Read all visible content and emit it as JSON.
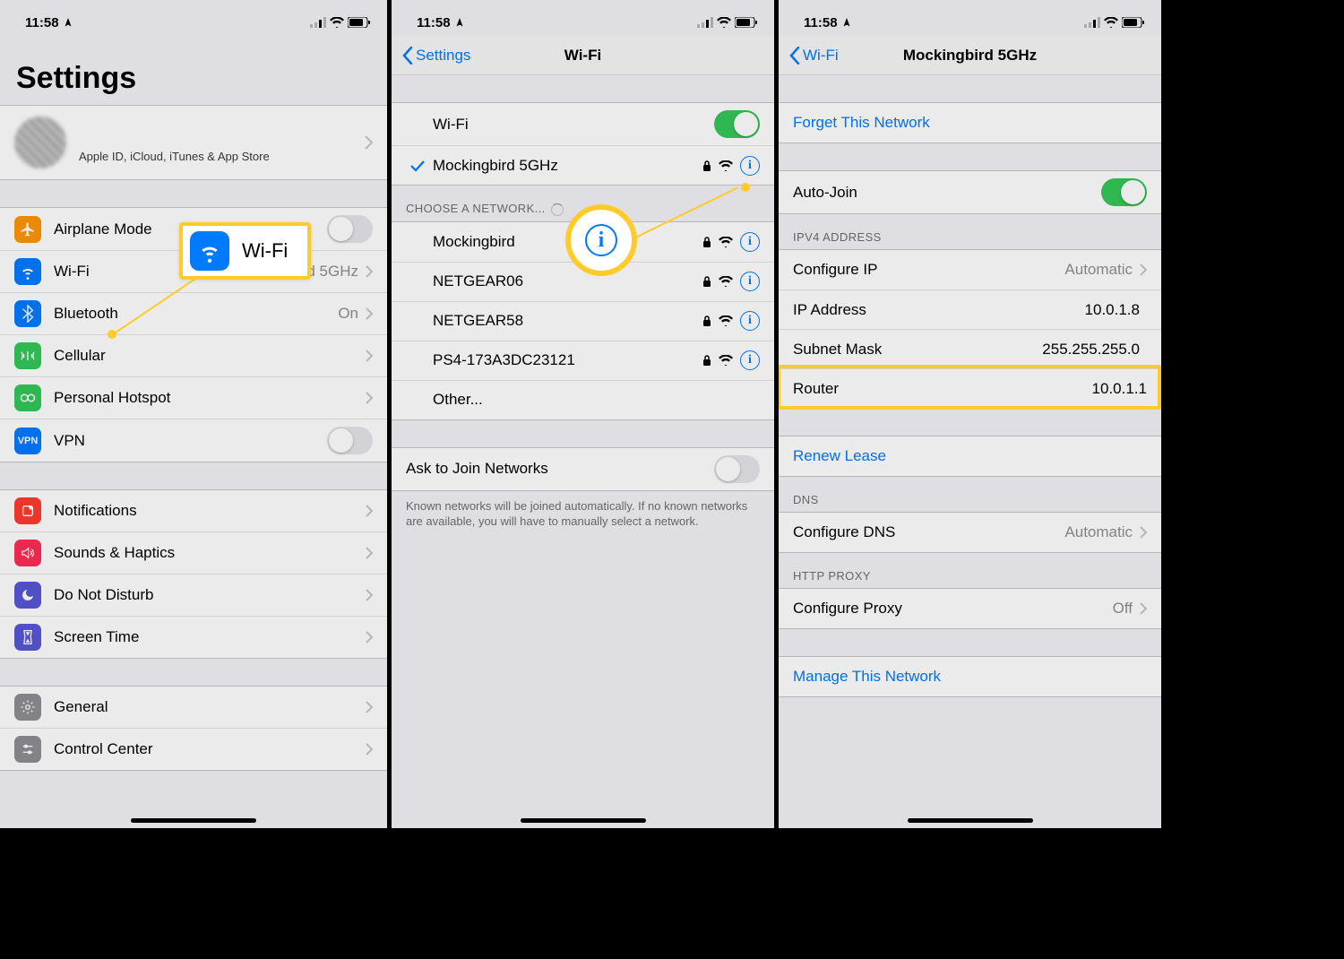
{
  "statusbar": {
    "time": "11:58"
  },
  "screen1": {
    "title": "Settings",
    "appleid_sub": "Apple ID, iCloud, iTunes & App Store",
    "rows": {
      "airplane": "Airplane Mode",
      "wifi": "Wi-Fi",
      "wifi_value": "Mockingbird 5GHz",
      "bluetooth": "Bluetooth",
      "bluetooth_value": "On",
      "cellular": "Cellular",
      "hotspot": "Personal Hotspot",
      "vpn": "VPN",
      "notifications": "Notifications",
      "sounds": "Sounds & Haptics",
      "dnd": "Do Not Disturb",
      "screentime": "Screen Time",
      "general": "General",
      "controlcenter": "Control Center"
    },
    "callout_wifi": "Wi-Fi"
  },
  "screen2": {
    "back": "Settings",
    "title": "Wi-Fi",
    "wifi_label": "Wi-Fi",
    "connected": "Mockingbird 5GHz",
    "choose_header": "CHOOSE A NETWORK...",
    "networks": [
      "Mockingbird",
      "NETGEAR06",
      "NETGEAR58",
      "PS4-173A3DC23121"
    ],
    "other": "Other...",
    "ask_label": "Ask to Join Networks",
    "ask_footer": "Known networks will be joined automatically. If no known networks are available, you will have to manually select a network."
  },
  "screen3": {
    "back": "Wi-Fi",
    "title": "Mockingbird 5GHz",
    "forget": "Forget This Network",
    "autojoin": "Auto-Join",
    "ipv4_header": "IPV4 ADDRESS",
    "configure_ip": "Configure IP",
    "configure_ip_value": "Automatic",
    "ip_address": "IP Address",
    "ip_address_value": "10.0.1.8",
    "subnet": "Subnet Mask",
    "subnet_value": "255.255.255.0",
    "router": "Router",
    "router_value": "10.0.1.1",
    "renew": "Renew Lease",
    "dns_header": "DNS",
    "configure_dns": "Configure DNS",
    "configure_dns_value": "Automatic",
    "proxy_header": "HTTP PROXY",
    "configure_proxy": "Configure Proxy",
    "configure_proxy_value": "Off",
    "manage": "Manage This Network"
  }
}
